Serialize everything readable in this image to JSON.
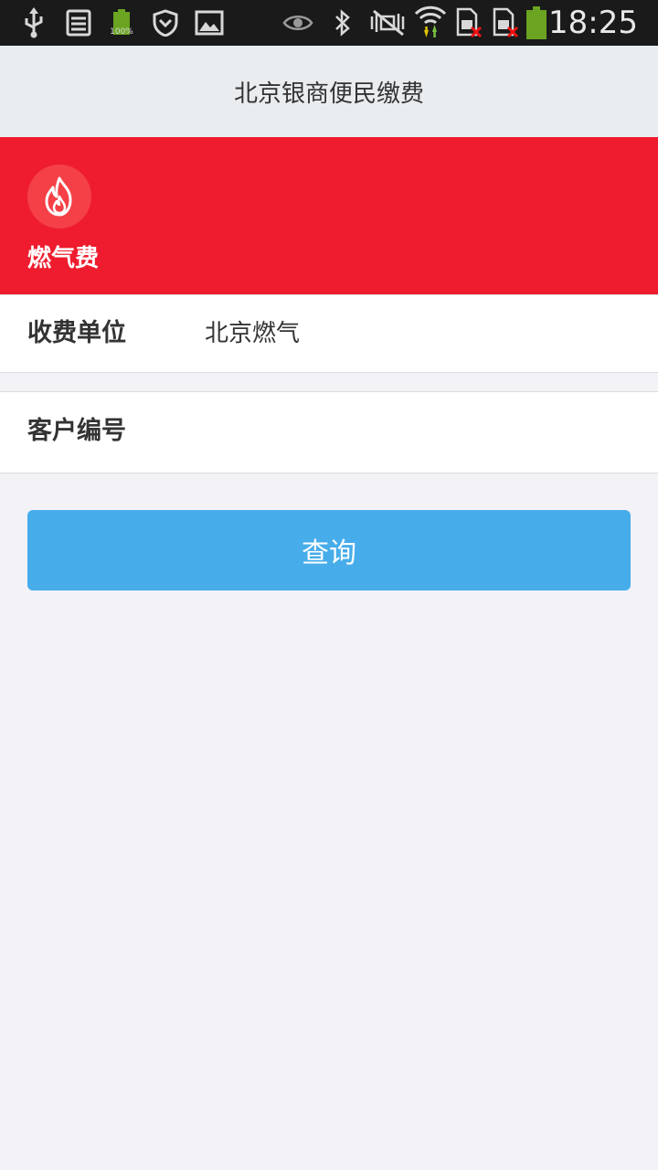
{
  "status_bar": {
    "time": "18:25",
    "battery_small_label": "100%",
    "icons": [
      "usb-icon",
      "storage-icon",
      "battery-small-icon",
      "shield-icon",
      "image-icon",
      "eye-icon",
      "bluetooth-icon",
      "mute-vibrate-icon",
      "wifi-icon",
      "sim-1-icon",
      "sim-2-icon",
      "battery-icon"
    ]
  },
  "header": {
    "title": "北京银商便民缴费"
  },
  "banner": {
    "icon": "flame-icon",
    "label": "燃气费",
    "color": "#ee1c2e"
  },
  "form": {
    "unit_label": "收费单位",
    "unit_value": "北京燃气",
    "customer_label": "客户编号",
    "customer_value": "",
    "customer_placeholder": ""
  },
  "actions": {
    "query_label": "查询",
    "query_color": "#47adea"
  }
}
